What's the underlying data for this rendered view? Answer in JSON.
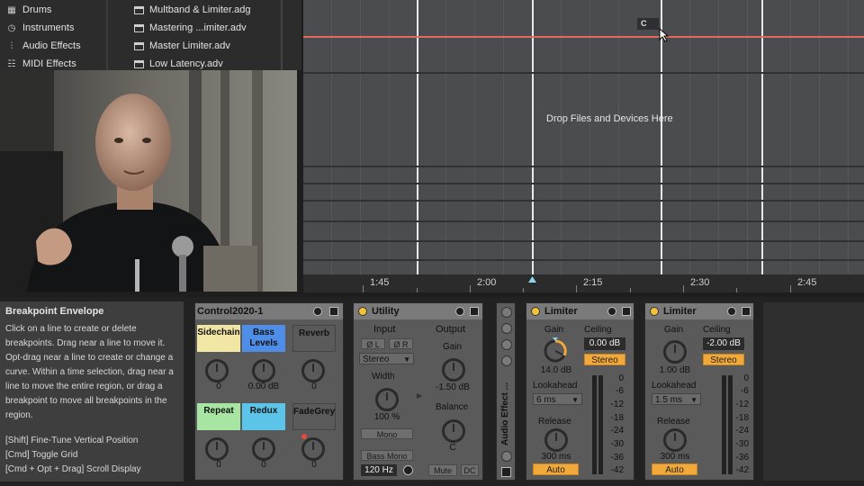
{
  "browser": {
    "categories": [
      {
        "label": "Drums",
        "icon": "drum-grid-icon"
      },
      {
        "label": "Instruments",
        "icon": "instrument-clock-icon"
      },
      {
        "label": "Audio Effects",
        "icon": "audio-wave-icon"
      },
      {
        "label": "MIDI Effects",
        "icon": "midi-sliders-icon"
      }
    ],
    "files": [
      {
        "label": "Multband & Limiter.adg"
      },
      {
        "label": "Mastering ...imiter.adv"
      },
      {
        "label": "Master Limiter.adv"
      },
      {
        "label": "Low Latency.adv"
      }
    ]
  },
  "arrangement": {
    "drop_text": "Drop Files and Devices Here",
    "tooltip": "C",
    "timeline": [
      "1:45",
      "2:00",
      "2:15",
      "2:30",
      "2:45"
    ]
  },
  "info": {
    "title": "Breakpoint Envelope",
    "body": "Click on a line to create or delete breakpoints. Drag near a line to move it. Opt-drag near a line to create or change a curve. Within a time selection, drag near a line to move the entire region, or drag a breakpoint to move all breakpoints in the region.",
    "shortcuts": [
      "[Shift] Fine-Tune Vertical Position",
      "[Cmd] Toggle Grid",
      "[Cmd + Opt + Drag] Scroll Display"
    ]
  },
  "control2020": {
    "title": "Control2020-1",
    "macros": [
      {
        "label": "Sidechain",
        "value": "0",
        "color": "#f2e6a4"
      },
      {
        "label": "Bass Levels",
        "value": "0.00 dB",
        "color": "#4e8ee8"
      },
      {
        "label": "Reverb",
        "value": "0",
        "color": "#5a5a5a"
      },
      {
        "label": "Repeat",
        "value": "0",
        "color": "#a7e6a2"
      },
      {
        "label": "Redux",
        "value": "0",
        "color": "#5cc4e8"
      },
      {
        "label": "FadeGrey",
        "value": "0",
        "color": "#5a5a5a"
      }
    ]
  },
  "utility": {
    "title": "Utility",
    "input_label": "Input",
    "output_label": "Output",
    "phase_l": "Ø L",
    "phase_r": "Ø R",
    "channel_mode": "Stereo",
    "width_label": "Width",
    "width_value": "100 %",
    "mono": "Mono",
    "bass_mono": "Bass Mono",
    "bass_freq": "120 Hz",
    "gain_label": "Gain",
    "gain_value": "-1.50 dB",
    "balance_label": "Balance",
    "balance_value": "C",
    "mute": "Mute",
    "dc": "DC"
  },
  "rack_strip": {
    "label": "Audio Effect ..."
  },
  "limiter1": {
    "title": "Limiter",
    "gain_label": "Gain",
    "gain_value": "14.0 dB",
    "ceiling_label": "Ceiling",
    "ceiling_value": "0.00 dB",
    "stereo": "Stereo",
    "lookahead_label": "Lookahead",
    "lookahead_value": "6 ms",
    "release_label": "Release",
    "release_value": "300 ms",
    "auto": "Auto",
    "scale": [
      "0",
      "-6",
      "-12",
      "-18",
      "-24",
      "-30",
      "-36",
      "-42"
    ]
  },
  "limiter2": {
    "title": "Limiter",
    "gain_label": "Gain",
    "gain_value": "1.00 dB",
    "ceiling_label": "Ceiling",
    "ceiling_value": "-2.00 dB",
    "stereo": "Stereo",
    "lookahead_label": "Lookahead",
    "lookahead_value": "1.5 ms",
    "release_label": "Release",
    "release_value": "300 ms",
    "auto": "Auto",
    "scale": [
      "0",
      "-6",
      "-12",
      "-18",
      "-24",
      "-30",
      "-36",
      "-42"
    ]
  },
  "colors": {
    "accent_orange": "#f1a93b",
    "automation_red": "#e26a5a",
    "power_yellow": "#f3c13c"
  }
}
